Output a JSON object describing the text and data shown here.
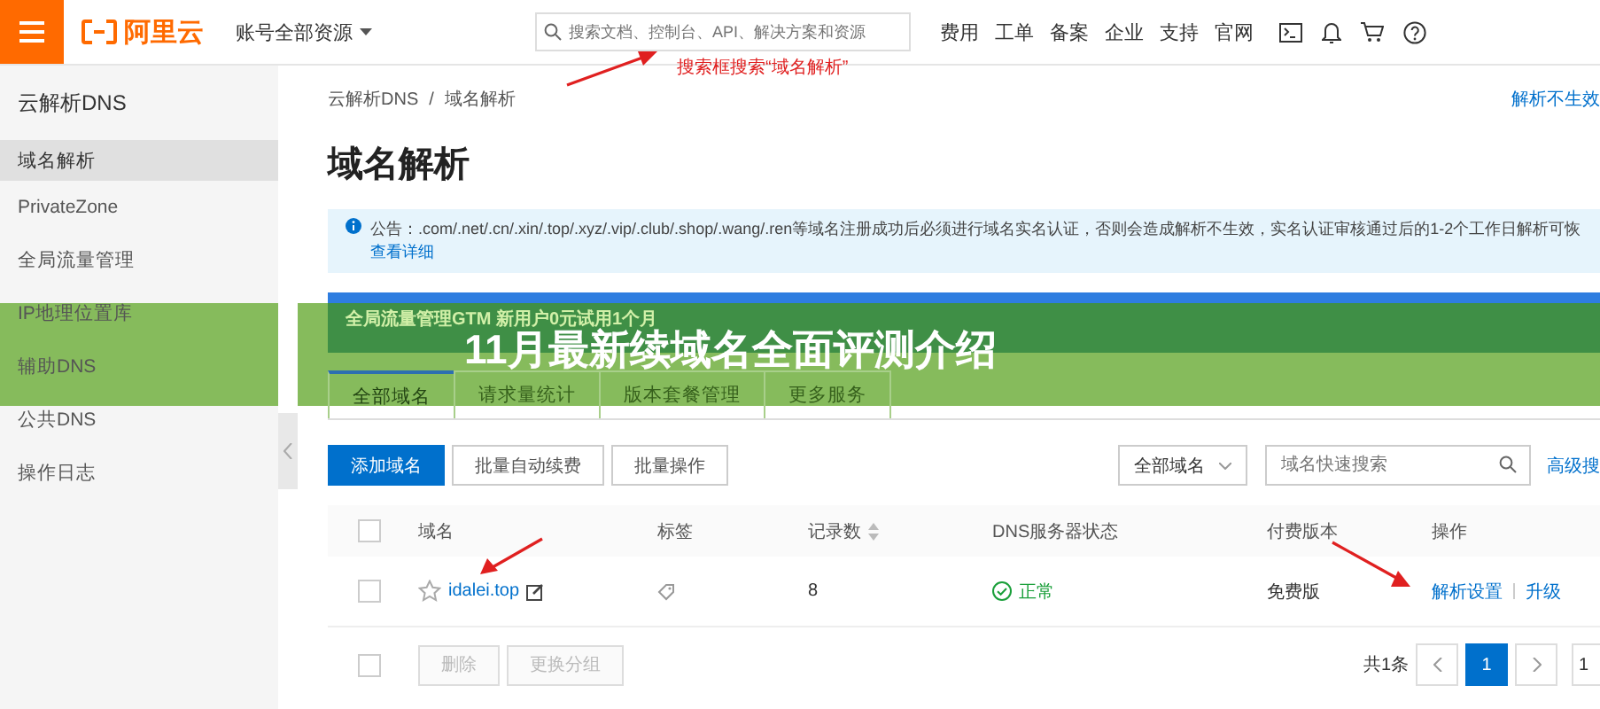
{
  "topbar": {
    "logo": "阿里云",
    "account_menu": "账号全部资源",
    "search": {
      "placeholder": "搜索文档、控制台、API、解决方案和资源"
    },
    "nav": [
      "费用",
      "工单",
      "备案",
      "企业",
      "支持",
      "官网"
    ]
  },
  "annotation": "搜索框搜索“域名解析”",
  "sidebar": {
    "title": "云解析DNS",
    "items": [
      {
        "label": "域名解析",
        "selected": true
      },
      {
        "label": "PrivateZone",
        "selected": false
      },
      {
        "label": "全局流量管理",
        "selected": false
      },
      {
        "label": "IP地理位置库",
        "selected": false
      },
      {
        "label": "辅助DNS",
        "selected": false
      },
      {
        "label": "公共DNS",
        "selected": false
      },
      {
        "label": "操作日志",
        "selected": false
      }
    ]
  },
  "breadcrumb": [
    "云解析DNS",
    "域名解析"
  ],
  "breadcrumb_separator": "/",
  "help_link": "解析不生效",
  "page_title": "域名解析",
  "notice": {
    "text": "公告：.com/.net/.cn/.xin/.top/.xyz/.vip/.club/.shop/.wang/.ren等域名注册成功后必须进行域名实名认证，否则会造成解析不生效，实名认证审核通过后的1-2个工作日解析可恢",
    "link": "查看详细"
  },
  "promo_banner": "全局流量管理GTM 新用户0元试用1个月",
  "tabs": [
    {
      "label": "全部域名",
      "selected": true
    },
    {
      "label": "请求量统计",
      "selected": false
    },
    {
      "label": "版本套餐管理",
      "selected": false
    },
    {
      "label": "更多服务",
      "selected": false
    }
  ],
  "toolbar": {
    "buttons": [
      "添加域名",
      "批量自动续费",
      "批量操作"
    ],
    "filter": "全部域名",
    "search": {
      "placeholder": "域名快速搜索"
    },
    "advanced_link": "高级搜"
  },
  "table": {
    "select_all_checked": false,
    "columns": [
      "域名",
      "标签",
      "记录数",
      "DNS服务器状态",
      "付费版本",
      "操作"
    ],
    "rows": [
      {
        "checked": false,
        "domain": "idalei.top",
        "records": "8",
        "dns_status": "正常",
        "plan": "免费版",
        "actions": [
          "解析设置",
          "升级"
        ]
      }
    ]
  },
  "footer": {
    "checked": false,
    "buttons": [
      {
        "label": "删除",
        "disabled": true
      },
      {
        "label": "更换分组",
        "disabled": true
      }
    ],
    "total": "共1条",
    "pages": [
      {
        "label": "1",
        "selected": true
      }
    ],
    "page_size": "1"
  },
  "overlay_title": "11月最新续域名全面评测介绍"
}
